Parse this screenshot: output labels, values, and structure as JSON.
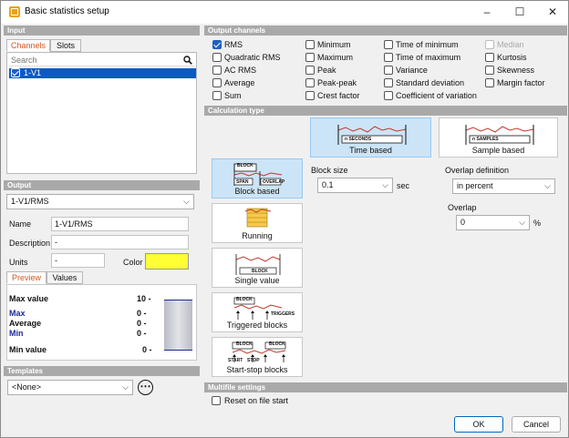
{
  "window": {
    "title": "Basic statistics setup",
    "minimize": "–",
    "maximize": "☐",
    "close": "✕"
  },
  "input": {
    "header": "Input",
    "tabs": [
      "Channels",
      "Slots"
    ],
    "search_placeholder": "Search",
    "channels": [
      {
        "name": "1-V1",
        "checked": true,
        "selected": true
      }
    ]
  },
  "output": {
    "header": "Output",
    "selected": "1-V1/RMS",
    "name_label": "Name",
    "name_value": "1-V1/RMS",
    "description_label": "Description",
    "description_value": "-",
    "units_label": "Units",
    "units_value": "-",
    "color_label": "Color",
    "color_value": "#ffff33",
    "tabs": [
      "Preview",
      "Values"
    ],
    "preview": {
      "max_value_label": "Max value",
      "max_value": "10 -",
      "max_label": "Max",
      "max": "0 -",
      "average_label": "Average",
      "average": "0 -",
      "min_label": "Min",
      "min": "0 -",
      "min_value_label": "Min value",
      "min_value": "0 -"
    }
  },
  "templates": {
    "header": "Templates",
    "selected": "<None>",
    "more": "⋯"
  },
  "output_channels": {
    "header": "Output channels",
    "col1": [
      {
        "label": "RMS",
        "checked": true
      },
      {
        "label": "Quadratic RMS",
        "checked": false
      },
      {
        "label": "AC RMS",
        "checked": false
      },
      {
        "label": "Average",
        "checked": false
      },
      {
        "label": "Sum",
        "checked": false
      }
    ],
    "col2": [
      {
        "label": "Minimum",
        "checked": false
      },
      {
        "label": "Maximum",
        "checked": false
      },
      {
        "label": "Peak",
        "checked": false
      },
      {
        "label": "Peak-peak",
        "checked": false
      },
      {
        "label": "Crest factor",
        "checked": false
      }
    ],
    "col3": [
      {
        "label": "Time of minimum",
        "checked": false
      },
      {
        "label": "Time of maximum",
        "checked": false
      },
      {
        "label": "Variance",
        "checked": false
      },
      {
        "label": "Standard deviation",
        "checked": false
      },
      {
        "label": "Coefficient of variation",
        "checked": false
      }
    ],
    "col4": [
      {
        "label": "Median",
        "checked": false,
        "disabled": true
      },
      {
        "label": "Kurtosis",
        "checked": false
      },
      {
        "label": "Skewness",
        "checked": false
      },
      {
        "label": "Margin factor",
        "checked": false
      }
    ]
  },
  "calc": {
    "header": "Calculation type",
    "types": [
      {
        "label": "Block based",
        "selected": true
      },
      {
        "label": "Running",
        "selected": false
      },
      {
        "label": "Single value",
        "selected": false
      },
      {
        "label": "Triggered blocks",
        "selected": false
      },
      {
        "label": "Start-stop blocks",
        "selected": false
      }
    ],
    "modes": [
      {
        "label": "Time based",
        "selected": true,
        "tag": "n SECONDS"
      },
      {
        "label": "Sample based",
        "selected": false,
        "tag": "n SAMPLES"
      }
    ],
    "block_size_label": "Block size",
    "block_size_value": "0.1",
    "block_size_unit": "sec",
    "overlap_def_label": "Overlap definition",
    "overlap_def_value": "in percent",
    "overlap_label": "Overlap",
    "overlap_value": "0",
    "overlap_unit": "%",
    "icon_text": {
      "block": "BLOCK",
      "span": "SPAN",
      "overlap": "OVERLAP",
      "triggers": "TRIGGERS",
      "start": "START",
      "stop": "STOP"
    }
  },
  "multifile": {
    "header": "Multifile settings",
    "reset_label": "Reset on file start",
    "reset_checked": false
  },
  "buttons": {
    "ok": "OK",
    "cancel": "Cancel"
  }
}
